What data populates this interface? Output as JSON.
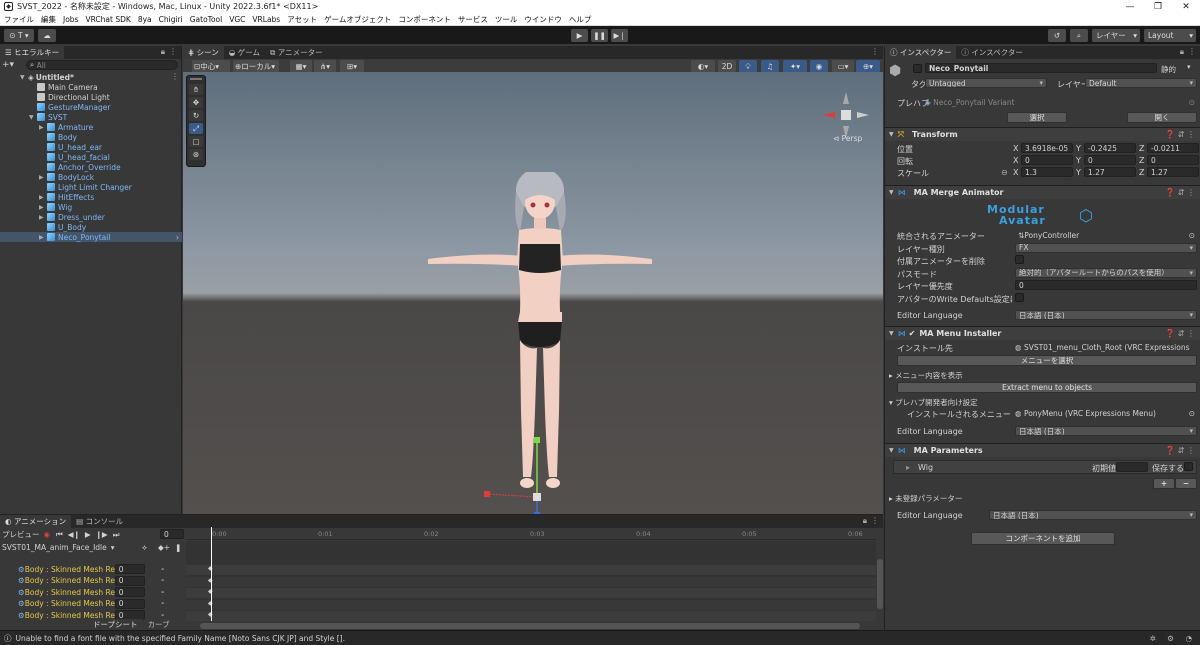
{
  "window": {
    "title": "SVST_2022 - 名称未設定 - Windows, Mac, Linux - Unity 2022.3.6f1* <DX11>"
  },
  "menu": [
    "ファイル",
    "編集",
    "Jobs",
    "VRChat SDK",
    "8ya",
    "Chigiri",
    "GatoTool",
    "VGC",
    "VRLabs",
    "アセット",
    "ゲームオブジェクト",
    "コンポーネント",
    "サービス",
    "ツール",
    "ウインドウ",
    "ヘルプ"
  ],
  "toolbar": {
    "account": "T",
    "layers": "レイヤー",
    "layout": "Layout"
  },
  "hierarchy": {
    "tab": "ヒエラルキー",
    "search_placeholder": "All",
    "scene": "Untitled*",
    "items": [
      {
        "label": "Main Camera",
        "depth": 1,
        "blue": false,
        "arrow": false
      },
      {
        "label": "Directional Light",
        "depth": 1,
        "blue": false,
        "arrow": false
      },
      {
        "label": "GestureManager",
        "depth": 1,
        "blue": true,
        "arrow": false
      },
      {
        "label": "SVST",
        "depth": 1,
        "blue": true,
        "arrow": true,
        "open": true
      },
      {
        "label": "Armature",
        "depth": 2,
        "blue": true,
        "arrow": true
      },
      {
        "label": "Body",
        "depth": 2,
        "blue": true,
        "arrow": false
      },
      {
        "label": "U_head_ear",
        "depth": 2,
        "blue": true,
        "arrow": false
      },
      {
        "label": "U_head_facial",
        "depth": 2,
        "blue": true,
        "arrow": false
      },
      {
        "label": "Anchor_Override",
        "depth": 2,
        "blue": true,
        "arrow": false
      },
      {
        "label": "BodyLock",
        "depth": 2,
        "blue": true,
        "arrow": true
      },
      {
        "label": "Light Limit Changer",
        "depth": 2,
        "blue": true,
        "arrow": false
      },
      {
        "label": "HitEffects",
        "depth": 2,
        "blue": true,
        "arrow": true
      },
      {
        "label": "Wig",
        "depth": 2,
        "blue": true,
        "arrow": true
      },
      {
        "label": "Dress_under",
        "depth": 2,
        "blue": true,
        "arrow": true
      },
      {
        "label": "U_Body",
        "depth": 2,
        "blue": true,
        "arrow": false
      },
      {
        "label": "Neco_Ponytail",
        "depth": 2,
        "blue": true,
        "arrow": true,
        "selected": true
      }
    ]
  },
  "scene_tabs": [
    "シーン",
    "ゲーム",
    "アニメーター"
  ],
  "scene_toolbar": {
    "pivot": "中心",
    "space": "ローカル",
    "mode2d": "2D"
  },
  "gizmo": {
    "label": "Persp"
  },
  "inspector": {
    "tabs": [
      "インスペクター",
      "インスペクター"
    ],
    "object_name": "Neco_Ponytail",
    "static": "静的",
    "tag_label": "タグ",
    "tag": "Untagged",
    "layer_label": "レイヤー",
    "layer": "Default",
    "prefab_label": "プレハブ",
    "prefab": "Neco_Ponytail Variant",
    "select_btn": "選択",
    "open_btn": "開く",
    "transform": {
      "title": "Transform",
      "position_label": "位置",
      "rotation_label": "回転",
      "scale_label": "スケール",
      "axes": [
        "X",
        "Y",
        "Z"
      ],
      "position": [
        "3.6918e-05",
        "-0.2425",
        "-0.0211"
      ],
      "rotation": [
        "0",
        "0",
        "0"
      ],
      "scale": [
        "1.3",
        "1.27",
        "1.27"
      ]
    },
    "merge_animator": {
      "title": "MA Merge Animator",
      "logo_top": "Modular",
      "logo_bottom": "Avatar",
      "rows": [
        {
          "label": "統合されるアニメーター",
          "value": "PonyController",
          "kind": "obj"
        },
        {
          "label": "レイヤー種別",
          "value": "FX",
          "kind": "dd"
        },
        {
          "label": "付属アニメーターを削除",
          "value": "",
          "kind": "chk"
        },
        {
          "label": "パスモード",
          "value": "絶対的（アバタールートからのパスを使用）",
          "kind": "dd"
        },
        {
          "label": "レイヤー優先度",
          "value": "0",
          "kind": "field"
        },
        {
          "label": "アバターのWrite Defaults設定に合わ",
          "value": "",
          "kind": "chk"
        }
      ],
      "lang_label": "Editor Language",
      "lang": "日本語 (日本)"
    },
    "menu_installer": {
      "title": "MA Menu Installer",
      "install_label": "インストール先",
      "install_value": "SVST01_menu_Cloth_Root (VRC Expressions",
      "select_menu_btn": "メニューを選択",
      "show_menu": "メニュー内容を表示",
      "extract_btn": "Extract menu to objects",
      "prefab_dev": "プレハブ開発者向け設定",
      "installed_label": "インストールされるメニュー",
      "installed_value": "PonyMenu (VRC Expressions Menu)",
      "lang_label": "Editor Language",
      "lang": "日本語 (日本)"
    },
    "parameters": {
      "title": "MA Parameters",
      "param": "Wig",
      "default_label": "初期値",
      "save_label": "保存する",
      "unregistered": "未登録パラメーター",
      "lang_label": "Editor Language",
      "lang": "日本語 (日本)"
    },
    "add_component": "コンポーネントを追加"
  },
  "animation": {
    "tabs": [
      "アニメーション",
      "コンソール"
    ],
    "preview": "プレビュー",
    "frame": "0",
    "clip": "SVST01_MA_anim_Face_Idle",
    "ruler": [
      "0:00",
      "0:01",
      "0:02",
      "0:03",
      "0:04",
      "0:05",
      "0:06"
    ],
    "props": [
      {
        "label": "Body : Skinned Mesh Re",
        "value": "0"
      },
      {
        "label": "Body : Skinned Mesh Re",
        "value": "0"
      },
      {
        "label": "Body : Skinned Mesh Re",
        "value": "0"
      },
      {
        "label": "Body : Skinned Mesh Re",
        "value": "0"
      },
      {
        "label": "Body : Skinned Mesh Re",
        "value": "0"
      }
    ],
    "bottom_tabs": [
      "ドープシート",
      "カーブ"
    ]
  },
  "status": {
    "message": "Unable to find a font file with the specified Family Name [Noto Sans CJK JP] and Style []."
  },
  "colors": {
    "accent": "#3a6ea5",
    "selected_row": "#44546a",
    "blue_item": "#7eb8f5"
  }
}
